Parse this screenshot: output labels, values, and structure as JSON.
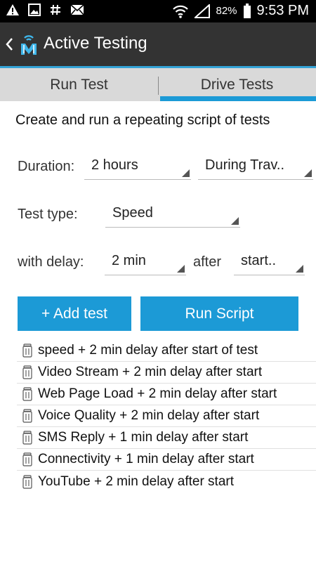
{
  "status_bar": {
    "battery": "82%",
    "time": "9:53 PM",
    "icons": [
      "warning-icon",
      "image-icon",
      "hash-icon",
      "mail-icon",
      "wifi-icon",
      "signal-icon",
      "battery-icon"
    ]
  },
  "header": {
    "title": "Active Testing"
  },
  "tabs": [
    {
      "label": "Run Test"
    },
    {
      "label": "Drive Tests",
      "selected": true
    }
  ],
  "main": {
    "intro": "Create and run a repeating script of tests",
    "duration": {
      "label": "Duration:",
      "value": "2 hours",
      "mode": "During Trav.."
    },
    "test_type": {
      "label": "Test type:",
      "value": "Speed"
    },
    "delay": {
      "label": "with delay:",
      "value": "2 min",
      "connector": "after",
      "anchor": "start.."
    },
    "add_button": "+ Add test",
    "run_button": "Run Script"
  },
  "tests": [
    {
      "text": "speed + 2 min delay after start of test"
    },
    {
      "text": "Video Stream + 2 min delay after start"
    },
    {
      "text": "Web Page Load + 2 min delay after start"
    },
    {
      "text": "Voice Quality + 2 min delay after start"
    },
    {
      "text": "SMS Reply + 1 min delay after start"
    },
    {
      "text": "Connectivity + 1 min delay after start"
    },
    {
      "text": "YouTube + 2 min delay after start"
    }
  ],
  "colors": {
    "accent": "#1c9ad6",
    "action_bar": "#333333",
    "tab_bar": "#d9d9d9"
  }
}
